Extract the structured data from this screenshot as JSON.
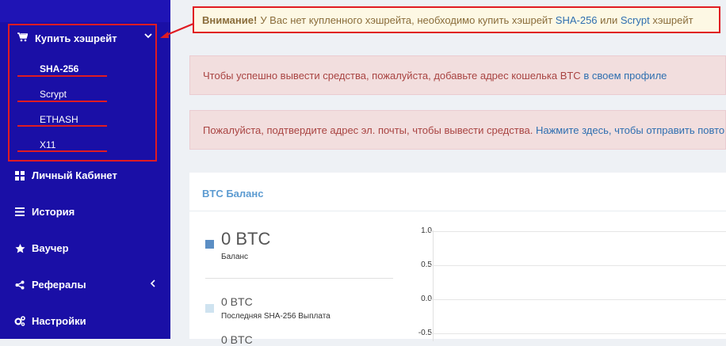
{
  "sidebar": {
    "buy_hashrate": {
      "label": "Купить хэшрейт",
      "icon": "cart-icon"
    },
    "sub_items": [
      {
        "label": "SHA-256",
        "active": true
      },
      {
        "label": "Scrypt"
      },
      {
        "label": "ETHASH"
      },
      {
        "label": "X11"
      }
    ],
    "items": [
      {
        "label": "Личный Кабинет",
        "icon": "grid-icon"
      },
      {
        "label": "История",
        "icon": "list-icon"
      },
      {
        "label": "Ваучер",
        "icon": "star-icon"
      },
      {
        "label": "Рефералы",
        "icon": "share-icon",
        "has_submenu": true
      },
      {
        "label": "Настройки",
        "icon": "cogs-icon"
      }
    ]
  },
  "warning": {
    "prefix": "Внимание!",
    "text1": "У Вас нет купленного хэшрейта, необходимо купить хэшрейт",
    "link1": "SHA-256",
    "text2": "или",
    "link2": "Scrypt",
    "text3": "хэшрейт"
  },
  "alerts": {
    "wallet_text": "Чтобы успешно вывести средства, пожалуйста, добавьте адрес кошелька BTC",
    "wallet_link": "в своем профиле",
    "email_text": "Пожалуйста, подтвердите адрес эл. почты, чтобы вывести средства.",
    "email_link": "Нажмите здесь, чтобы отправить повторно"
  },
  "balance_panel": {
    "title": "BTC Баланс",
    "stats": [
      {
        "value": "0 BTC",
        "label": "Баланс",
        "color": "#5b8ec4"
      },
      {
        "value": "0 BTC",
        "label": "Последняя SHA-256 Выплата",
        "color": "#cfe3f0"
      },
      {
        "value": "0 BTC"
      }
    ],
    "chart_ticks": [
      "1.0",
      "0.5",
      "0.0",
      "-0.5"
    ]
  },
  "colors": {
    "sidebar": "#1a0fa6",
    "highlight": "#e01b22",
    "link": "#2f6fb0"
  }
}
